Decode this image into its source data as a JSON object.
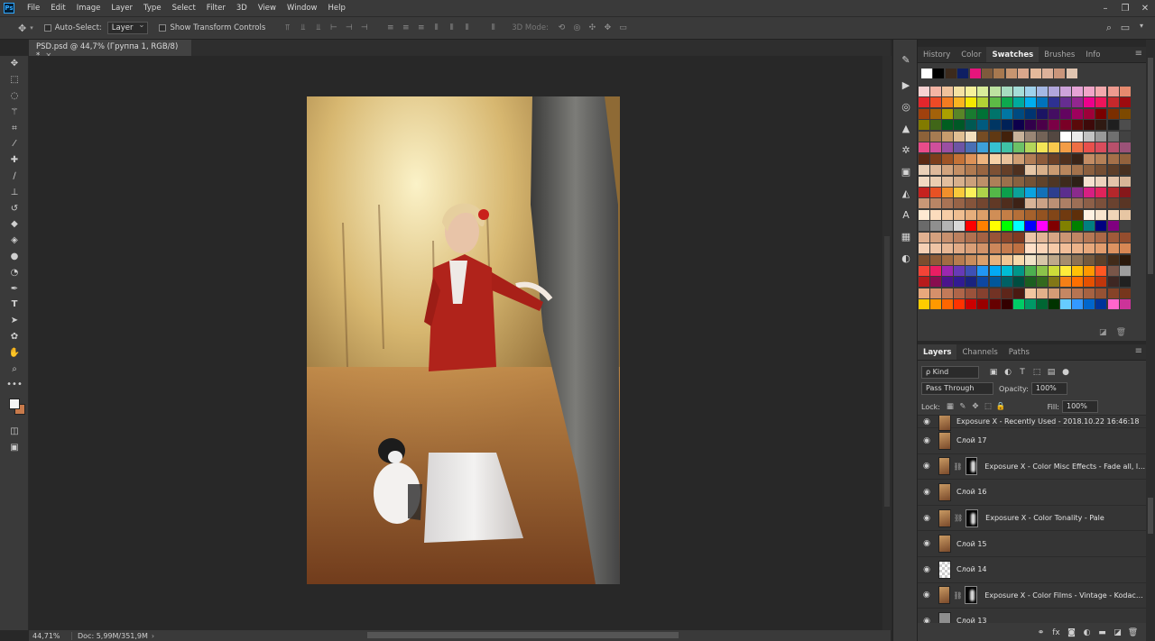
{
  "app": {
    "logo_text": "Ps"
  },
  "menu": [
    "File",
    "Edit",
    "Image",
    "Layer",
    "Type",
    "Select",
    "Filter",
    "3D",
    "View",
    "Window",
    "Help"
  ],
  "options": {
    "auto_select_label": "Auto-Select:",
    "auto_select_value": "Layer",
    "show_transform_label": "Show Transform Controls",
    "mode_3d_label": "3D Mode:"
  },
  "document": {
    "tab_title": "PSD.psd @ 44,7% (Группа 1, RGB/8) *",
    "close": "×"
  },
  "status": {
    "zoom": "44,71%",
    "doc": "Doc: 5,99M/351,9M",
    "caret": "›"
  },
  "swatches": {
    "tabs": [
      "History",
      "Color",
      "Swatches",
      "Brushes",
      "Info"
    ],
    "active_tab": "Swatches",
    "recent": [
      "#ffffff",
      "#000000",
      "#3c2a1c",
      "#0e1f63",
      "#e5157c",
      "#7e5a3c",
      "#a7784f",
      "#c79570",
      "#d9a78c",
      "#e4b99b",
      "#dcb19a",
      "#c9957b",
      "#e0c4b0"
    ],
    "palette": [
      "#f7d2d2",
      "#f4b4a4",
      "#f0c29c",
      "#f4e2a2",
      "#f6f19b",
      "#d9ec9a",
      "#bde2a0",
      "#a7dcc0",
      "#a5ddd8",
      "#a0d2ec",
      "#a4b8e4",
      "#b1a7dc",
      "#cda3db",
      "#e6a3d6",
      "#f0a5c8",
      "#f3a9ad",
      "#ee9a8f",
      "#e68a6e",
      "#e3262c",
      "#ee4a26",
      "#f37c21",
      "#f8b421",
      "#f4e800",
      "#b2d235",
      "#5dbb46",
      "#0da84e",
      "#00a99d",
      "#00aeef",
      "#0072bc",
      "#2e3192",
      "#662d91",
      "#92278f",
      "#ec008c",
      "#ed145b",
      "#c6282c",
      "#9e0b0f",
      "#a0410d",
      "#a3620a",
      "#aba000",
      "#598527",
      "#197b30",
      "#007236",
      "#00746b",
      "#0076a3",
      "#004a80",
      "#003471",
      "#1b1464",
      "#440e62",
      "#630460",
      "#9e005d",
      "#9e0039",
      "#790000",
      "#7b2e00",
      "#7d4900",
      "#827b00",
      "#406618",
      "#005e20",
      "#005826",
      "#005952",
      "#005b7f",
      "#003663",
      "#002157",
      "#0d004c",
      "#32004b",
      "#4b0049",
      "#7b0046",
      "#7a0026",
      "#5a0a0a",
      "#3e0a0a",
      "#2f1a12",
      "#1f1f1f",
      "#4d4d4d",
      "#8c6239",
      "#a67c52",
      "#c69c6d",
      "#e0bf93",
      "#f2dfbe",
      "#754c24",
      "#603913",
      "#42210b",
      "#c7b299",
      "#998675",
      "#736357",
      "#534741",
      "#ffffff",
      "#ebebeb",
      "#c2c2c2",
      "#999999",
      "#707070",
      "#424242",
      "#e84c8a",
      "#cf4f9c",
      "#9b4fa3",
      "#6d55a4",
      "#4a6fb4",
      "#3da0d9",
      "#36c1d0",
      "#3fc1a5",
      "#6cc167",
      "#b3d55a",
      "#f3e556",
      "#f8c84d",
      "#f39d46",
      "#ee6f45",
      "#e8504c",
      "#d94c5c",
      "#b8506b",
      "#9b5278",
      "#5b2a14",
      "#7d3d1c",
      "#9f5325",
      "#c47237",
      "#dd9257",
      "#eeb47e",
      "#f6d2a8",
      "#e9c29b",
      "#cf9f74",
      "#b27d55",
      "#8d5b3a",
      "#6b4027",
      "#50301e",
      "#3a2317",
      "#c38c64",
      "#b58057",
      "#a57049",
      "#93623d",
      "#ead0b8",
      "#dfb99b",
      "#d2a47e",
      "#c48f65",
      "#b07a50",
      "#986541",
      "#7d5134",
      "#653f28",
      "#4e301f",
      "#e6c7a7",
      "#d8b08a",
      "#c99b72",
      "#b8865d",
      "#a3724c",
      "#8b5f3e",
      "#744e33",
      "#5d3e29",
      "#483020",
      "#f1d9c2",
      "#ebcdb1",
      "#e2bf9f",
      "#d7b08d",
      "#cba07b",
      "#bd9069",
      "#ad8059",
      "#9b704c",
      "#886140",
      "#745235",
      "#60432b",
      "#4e3623",
      "#3d2a1c",
      "#2d2016",
      "#f5e1cf",
      "#edd3bd",
      "#e3c4aa",
      "#d8b597",
      "#c5221f",
      "#e75124",
      "#f1902c",
      "#f8c93b",
      "#faf05a",
      "#aed34a",
      "#54b848",
      "#0c9f4c",
      "#0ca199",
      "#0aa3e0",
      "#1371b8",
      "#2d3f8f",
      "#5b2e8e",
      "#8a2b8c",
      "#d71f83",
      "#e0235b",
      "#b4272b",
      "#86171a",
      "#c99776",
      "#b98565",
      "#a87355",
      "#976347",
      "#85543b",
      "#734630",
      "#613926",
      "#4f2d1d",
      "#3d2216",
      "#d8b498",
      "#cba286",
      "#bc9075",
      "#ad7f65",
      "#9d6f56",
      "#8c5f48",
      "#7b503b",
      "#6a422f",
      "#593524",
      "#ffe9d2",
      "#fcdcbd",
      "#f6cda6",
      "#efbe91",
      "#e6ae7c",
      "#dc9e68",
      "#d08e56",
      "#c37e46",
      "#b56f38",
      "#a5612c",
      "#945321",
      "#824618",
      "#703a10",
      "#5e2f0a",
      "#fff2e2",
      "#f8e4cd",
      "#f0d5b8",
      "#e7c6a3",
      "#6a6a6a",
      "#8f8f8f",
      "#b4b4b4",
      "#d9d9d9",
      "#ff0000",
      "#ff8000",
      "#ffff00",
      "#00ff00",
      "#00ffff",
      "#0000ff",
      "#ff00ff",
      "#800000",
      "#808000",
      "#008000",
      "#008080",
      "#000080",
      "#800080",
      "#404040",
      "#e0b090",
      "#d4a07e",
      "#c8906e",
      "#bc805f",
      "#b07150",
      "#a46243",
      "#985437",
      "#8c472c",
      "#803b22",
      "#ecc5a8",
      "#e1b596",
      "#d6a585",
      "#cb9574",
      "#c08664",
      "#b57755",
      "#aa6847",
      "#9f5a3a",
      "#944d2e",
      "#f5d0b5",
      "#efc4a5",
      "#e8b895",
      "#e1ab86",
      "#da9f77",
      "#d39369",
      "#cc875b",
      "#c57b4e",
      "#be7042",
      "#ffe0c8",
      "#fbd5b8",
      "#f6caa8",
      "#f1be99",
      "#ecb38a",
      "#e7a87c",
      "#e29d6e",
      "#dd9261",
      "#d88754",
      "#7a4d2e",
      "#8e5c38",
      "#a26c43",
      "#b67c4f",
      "#c98d5c",
      "#db9f6b",
      "#e8b27e",
      "#f1c593",
      "#f7d8aa",
      "#f1e3c8",
      "#d8c6a8",
      "#bfa98a",
      "#a68d6e",
      "#8d7255",
      "#74593e",
      "#5b412a",
      "#422b19",
      "#2b190c",
      "#f44336",
      "#e91e63",
      "#9c27b0",
      "#673ab7",
      "#3f51b5",
      "#2196f3",
      "#03a9f4",
      "#00bcd4",
      "#009688",
      "#4caf50",
      "#8bc34a",
      "#cddc39",
      "#ffeb3b",
      "#ffc107",
      "#ff9800",
      "#ff5722",
      "#795548",
      "#9e9e9e",
      "#b71c1c",
      "#880e4f",
      "#4a148c",
      "#311b92",
      "#1a237e",
      "#0d47a1",
      "#01579b",
      "#006064",
      "#004d40",
      "#1b5e20",
      "#33691e",
      "#827717",
      "#f57f17",
      "#ff6f00",
      "#e65100",
      "#bf360c",
      "#3e2723",
      "#212121",
      "#e8a87c",
      "#d5906a",
      "#c27a59",
      "#ae6549",
      "#9a523b",
      "#86412f",
      "#723224",
      "#5e251a",
      "#4a1a12",
      "#f2c6a0",
      "#e3b08a",
      "#d49b76",
      "#c58763",
      "#b67452",
      "#a66242",
      "#965234",
      "#864327",
      "#76361c",
      "#ffcc00",
      "#ff9900",
      "#ff6600",
      "#ff3300",
      "#cc0000",
      "#990000",
      "#660000",
      "#330000",
      "#00cc66",
      "#009966",
      "#006633",
      "#003300",
      "#66ccff",
      "#3399ff",
      "#0066cc",
      "#003399",
      "#ff66cc",
      "#cc3399"
    ],
    "footer": [
      "new-swatch-icon",
      "delete-swatch-icon"
    ]
  },
  "layers": {
    "tabs": [
      "Layers",
      "Channels",
      "Paths"
    ],
    "active_tab": "Layers",
    "kind_label": "ρ Kind",
    "blend_mode": "Pass Through",
    "opacity_label": "Opacity:",
    "opacity_value": "100%",
    "lock_label": "Lock:",
    "fill_label": "Fill:",
    "fill_value": "100%",
    "items": [
      {
        "name": "Exposure X - Recently Used - 2018.10.22 16:46:18",
        "thumb": "photo",
        "mask": false
      },
      {
        "name": "Слой 17",
        "thumb": "photo",
        "mask": false
      },
      {
        "name": "Exposure X - Color Misc Effects - Fade all, le...",
        "thumb": "photo",
        "mask": true
      },
      {
        "name": "Слой 16",
        "thumb": "photo",
        "mask": false
      },
      {
        "name": "Exposure X - Color Tonality - Pale",
        "thumb": "photo",
        "mask": true
      },
      {
        "name": "Слой 15",
        "thumb": "photo",
        "mask": false
      },
      {
        "name": "Слой 14",
        "thumb": "trans",
        "mask": false
      },
      {
        "name": "Exposure X - Color Films - Vintage - Kodachr...",
        "thumb": "photo",
        "mask": true
      },
      {
        "name": "Слой 13",
        "thumb": "plain",
        "mask": false
      }
    ]
  }
}
